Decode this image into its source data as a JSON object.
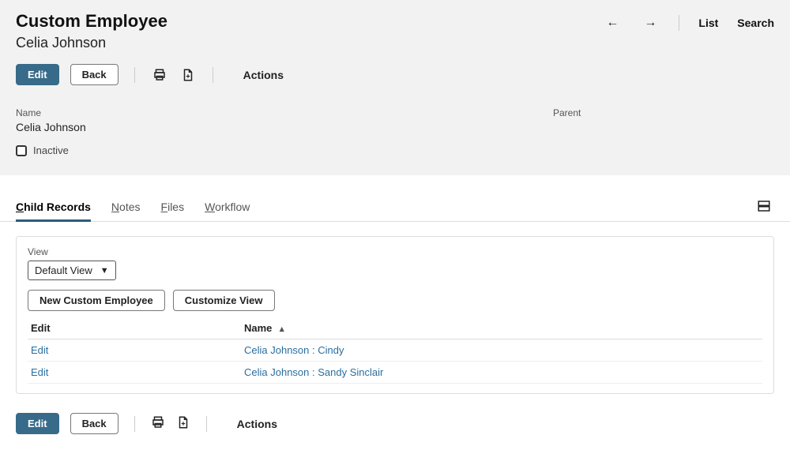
{
  "header": {
    "title": "Custom Employee",
    "subtitle": "Celia Johnson",
    "nav": {
      "back_arrow": "←",
      "forward_arrow": "→",
      "list": "List",
      "search": "Search"
    }
  },
  "toolbar": {
    "edit": "Edit",
    "back": "Back",
    "actions": "Actions"
  },
  "fields": {
    "name_label": "Name",
    "name_value": "Celia Johnson",
    "inactive_label": "Inactive",
    "inactive_checked": false,
    "parent_label": "Parent",
    "parent_value": ""
  },
  "tabs": {
    "child_records": "Child Records",
    "notes": "Notes",
    "files": "Files",
    "workflow": "Workflow",
    "active": "child_records"
  },
  "panel": {
    "view_label": "View",
    "view_selected": "Default View",
    "new_button": "New Custom Employee",
    "customize_button": "Customize View",
    "columns": {
      "edit": "Edit",
      "name": "Name",
      "sort_dir": "asc"
    },
    "rows": [
      {
        "edit": "Edit",
        "name": "Celia Johnson : Cindy"
      },
      {
        "edit": "Edit",
        "name": "Celia Johnson : Sandy Sinclair"
      }
    ]
  }
}
